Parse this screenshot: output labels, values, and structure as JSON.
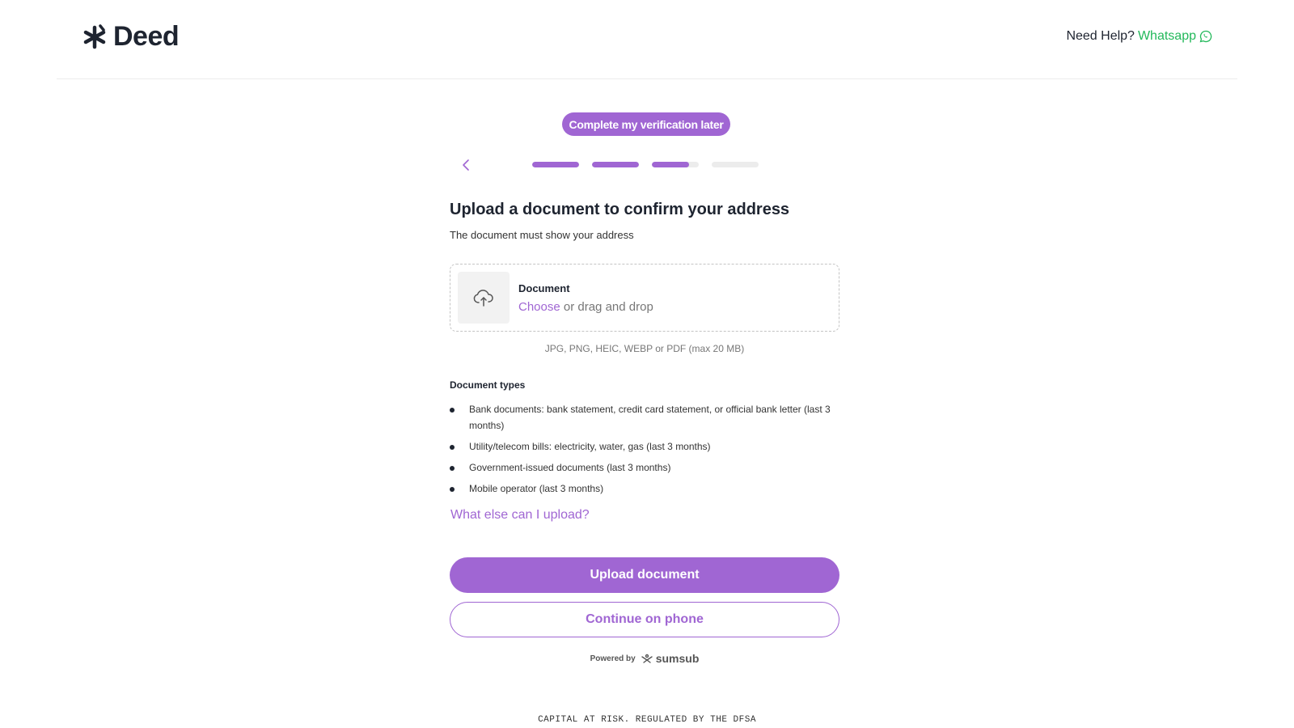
{
  "header": {
    "logo_text": "Deed",
    "help_label": "Need Help?",
    "help_link": "Whatsapp"
  },
  "verification_later_label": "Complete my verification later",
  "progress": {
    "segments": [
      1,
      1,
      0.8,
      0
    ]
  },
  "main": {
    "title": "Upload a document to confirm your address",
    "subtitle": "The document must show your address"
  },
  "dropzone": {
    "label": "Document",
    "choose_text": "Choose",
    "drag_text": " or drag and drop"
  },
  "formats_note": "JPG, PNG, HEIC, WEBP or PDF (max 20 MB)",
  "document_types": {
    "title": "Document types",
    "items": [
      "Bank documents: bank statement, credit card statement, or official bank letter (last 3 months)",
      "Utility/telecom bills: electricity, water, gas (last 3 months)",
      "Government-issued documents (last 3 months)",
      "Mobile operator (last 3 months)"
    ]
  },
  "what_else_link": "What else can I upload?",
  "buttons": {
    "upload": "Upload document",
    "continue_phone": "Continue on phone"
  },
  "powered_by": {
    "label": "Powered by",
    "brand": "sumsub"
  },
  "footer_text": "CAPITAL AT RISK. REGULATED BY THE DFSA",
  "colors": {
    "accent": "#a066d3",
    "whatsapp": "#22b85a",
    "text_dark": "#1e2430"
  }
}
